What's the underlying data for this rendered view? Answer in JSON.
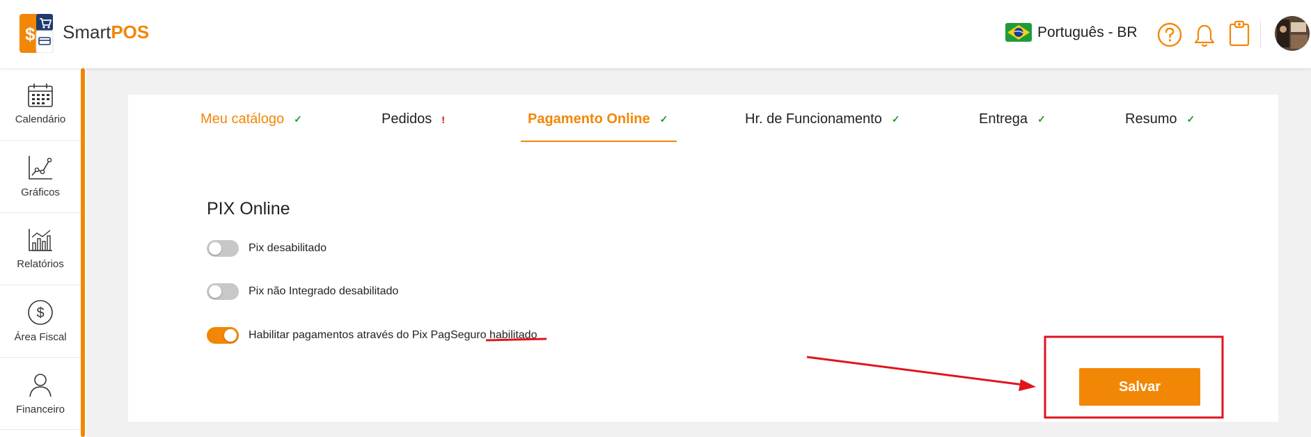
{
  "header": {
    "brand_part1": "Smart",
    "brand_part2": "POS",
    "language": "Português - BR"
  },
  "sidebar": {
    "items": [
      {
        "label": "Calendário",
        "icon": "calendar-icon"
      },
      {
        "label": "Gráficos",
        "icon": "line-chart-icon"
      },
      {
        "label": "Relatórios",
        "icon": "bar-chart-icon"
      },
      {
        "label": "Área Fiscal",
        "icon": "dollar-circle-icon"
      },
      {
        "label": "Financeiro",
        "icon": "person-icon"
      }
    ]
  },
  "tabs": [
    {
      "label": "Meu catálogo",
      "status": "✓"
    },
    {
      "label": "Pedidos",
      "status": "!"
    },
    {
      "label": "Pagamento Online",
      "status": "✓"
    },
    {
      "label": "Hr. de Funcionamento",
      "status": "✓"
    },
    {
      "label": "Entrega",
      "status": "✓"
    },
    {
      "label": "Resumo",
      "status": "✓"
    }
  ],
  "section": {
    "title": "PIX Online",
    "options": [
      {
        "label": "Pix desabilitado",
        "enabled": false
      },
      {
        "label": "Pix não Integrado desabilitado",
        "enabled": false
      },
      {
        "label": "Habilitar pagamentos através do Pix PagSeguro habilitado",
        "enabled": true
      }
    ]
  },
  "actions": {
    "save_label": "Salvar"
  },
  "colors": {
    "accent": "#f28705",
    "check": "#1a9a2a",
    "warning": "#d40000",
    "annotation": "#e0141e"
  }
}
